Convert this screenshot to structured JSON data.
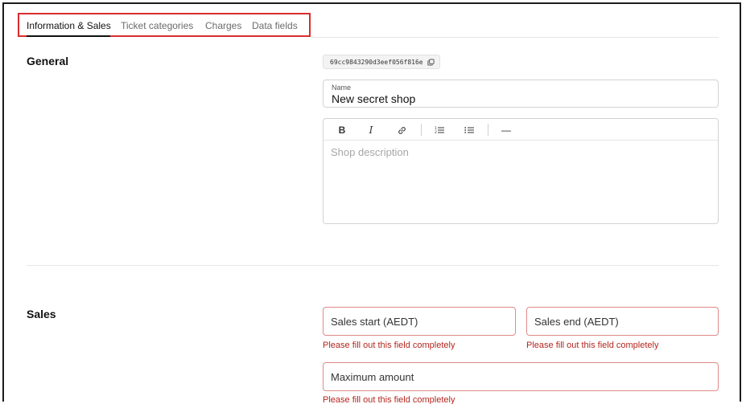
{
  "tabs": [
    {
      "label": "Information & Sales",
      "active": true
    },
    {
      "label": "Ticket categories",
      "active": false
    },
    {
      "label": "Charges",
      "active": false
    },
    {
      "label": "Data fields",
      "active": false
    }
  ],
  "general": {
    "title": "General",
    "shop_id": "69cc9843290d3eef056f816e",
    "name_field": {
      "label": "Name",
      "value": "New secret shop"
    },
    "description": {
      "placeholder": "Shop description"
    },
    "toolbar": {
      "bold": "B",
      "italic": "I",
      "link_icon": "link-icon",
      "ordered_list_icon": "ordered-list-icon",
      "bullet_list_icon": "bullet-list-icon",
      "hr": "—"
    }
  },
  "sales": {
    "title": "Sales",
    "start": {
      "placeholder": "Sales start (AEDT)",
      "error": "Please fill out this field completely"
    },
    "end": {
      "placeholder": "Sales end (AEDT)",
      "error": "Please fill out this field completely"
    },
    "max": {
      "placeholder": "Maximum amount",
      "error": "Please fill out this field completely"
    }
  },
  "colors": {
    "accent_outline": "#d72e2e",
    "error_text": "#b3261e",
    "error_border": "#e08a8a"
  }
}
